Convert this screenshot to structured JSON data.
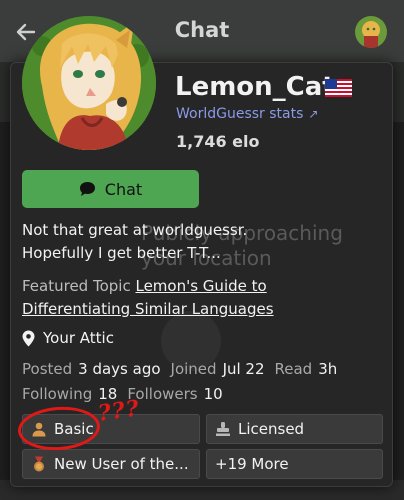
{
  "header": {
    "title": "Chat"
  },
  "profile": {
    "username": "Lemon_Cat",
    "stats_link": "WorldGuessr stats",
    "elo": "1,746 elo",
    "chat_button": "Chat",
    "bio": [
      "Not that great at worldguessr.",
      "Hopefully I get better T-T..."
    ],
    "featured_label": "Featured Topic",
    "featured_link": "Lemon's Guide to Differentiating Similar Languages",
    "location": "Your Attic",
    "posted_label": "Posted",
    "posted_value": "3 days ago",
    "joined_label": "Joined",
    "joined_value": "Jul 22",
    "read_label": "Read",
    "read_value": "3h",
    "following_label": "Following",
    "following_value": "18",
    "followers_label": "Followers",
    "followers_value": "10"
  },
  "badges": {
    "basic": "Basic",
    "licensed": "Licensed",
    "new_user": "New User of the...",
    "more": "+19 More"
  },
  "annotation": {
    "marks": "???"
  },
  "background": {
    "partial_text": [
      "Pubicly approaching",
      "your location"
    ]
  },
  "icons": {
    "back": "arrow-left-icon",
    "flag": "us-flag-icon",
    "stats_arrow": "arrow-up-right-icon",
    "chat": "speech-bubble-icon",
    "location": "map-pin-icon",
    "basic": "user-icon",
    "licensed": "stamp-icon",
    "new_user": "medal-icon"
  },
  "colors": {
    "card_bg": "#262626",
    "accent_green": "#4ea552",
    "link_blue": "#8a9be8",
    "annotation_red": "#e01818",
    "badge_bg": "#3a3a3a"
  }
}
